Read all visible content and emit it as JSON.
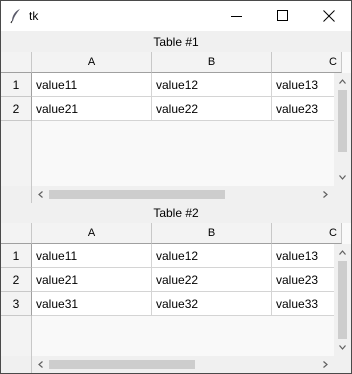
{
  "window": {
    "title": "tk",
    "icon": "feather-icon"
  },
  "controls": {
    "minimize": "minimize-icon",
    "maximize": "maximize-icon",
    "close": "close-icon"
  },
  "tables": [
    {
      "title": "Table #1",
      "columns": [
        "A",
        "B",
        "C"
      ],
      "rows": [
        {
          "index": "1",
          "cells": [
            "value11",
            "value12",
            "value13"
          ]
        },
        {
          "index": "2",
          "cells": [
            "value21",
            "value22",
            "value23"
          ]
        }
      ]
    },
    {
      "title": "Table #2",
      "columns": [
        "A",
        "B",
        "C"
      ],
      "rows": [
        {
          "index": "1",
          "cells": [
            "value11",
            "value12",
            "value13"
          ]
        },
        {
          "index": "2",
          "cells": [
            "value21",
            "value22",
            "value23"
          ]
        },
        {
          "index": "3",
          "cells": [
            "value31",
            "value32",
            "value33"
          ]
        }
      ]
    }
  ]
}
